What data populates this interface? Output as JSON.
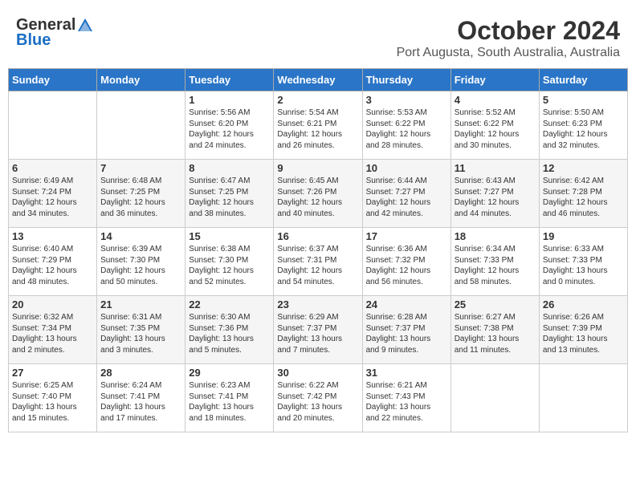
{
  "header": {
    "logo_general": "General",
    "logo_blue": "Blue",
    "month_title": "October 2024",
    "subtitle": "Port Augusta, South Australia, Australia"
  },
  "days_of_week": [
    "Sunday",
    "Monday",
    "Tuesday",
    "Wednesday",
    "Thursday",
    "Friday",
    "Saturday"
  ],
  "weeks": [
    {
      "row_class": "row-white",
      "days": [
        {
          "num": "",
          "info": ""
        },
        {
          "num": "",
          "info": ""
        },
        {
          "num": "1",
          "info": "Sunrise: 5:56 AM\nSunset: 6:20 PM\nDaylight: 12 hours\nand 24 minutes."
        },
        {
          "num": "2",
          "info": "Sunrise: 5:54 AM\nSunset: 6:21 PM\nDaylight: 12 hours\nand 26 minutes."
        },
        {
          "num": "3",
          "info": "Sunrise: 5:53 AM\nSunset: 6:22 PM\nDaylight: 12 hours\nand 28 minutes."
        },
        {
          "num": "4",
          "info": "Sunrise: 5:52 AM\nSunset: 6:22 PM\nDaylight: 12 hours\nand 30 minutes."
        },
        {
          "num": "5",
          "info": "Sunrise: 5:50 AM\nSunset: 6:23 PM\nDaylight: 12 hours\nand 32 minutes."
        }
      ]
    },
    {
      "row_class": "row-alt",
      "days": [
        {
          "num": "6",
          "info": "Sunrise: 6:49 AM\nSunset: 7:24 PM\nDaylight: 12 hours\nand 34 minutes."
        },
        {
          "num": "7",
          "info": "Sunrise: 6:48 AM\nSunset: 7:25 PM\nDaylight: 12 hours\nand 36 minutes."
        },
        {
          "num": "8",
          "info": "Sunrise: 6:47 AM\nSunset: 7:25 PM\nDaylight: 12 hours\nand 38 minutes."
        },
        {
          "num": "9",
          "info": "Sunrise: 6:45 AM\nSunset: 7:26 PM\nDaylight: 12 hours\nand 40 minutes."
        },
        {
          "num": "10",
          "info": "Sunrise: 6:44 AM\nSunset: 7:27 PM\nDaylight: 12 hours\nand 42 minutes."
        },
        {
          "num": "11",
          "info": "Sunrise: 6:43 AM\nSunset: 7:27 PM\nDaylight: 12 hours\nand 44 minutes."
        },
        {
          "num": "12",
          "info": "Sunrise: 6:42 AM\nSunset: 7:28 PM\nDaylight: 12 hours\nand 46 minutes."
        }
      ]
    },
    {
      "row_class": "row-white",
      "days": [
        {
          "num": "13",
          "info": "Sunrise: 6:40 AM\nSunset: 7:29 PM\nDaylight: 12 hours\nand 48 minutes."
        },
        {
          "num": "14",
          "info": "Sunrise: 6:39 AM\nSunset: 7:30 PM\nDaylight: 12 hours\nand 50 minutes."
        },
        {
          "num": "15",
          "info": "Sunrise: 6:38 AM\nSunset: 7:30 PM\nDaylight: 12 hours\nand 52 minutes."
        },
        {
          "num": "16",
          "info": "Sunrise: 6:37 AM\nSunset: 7:31 PM\nDaylight: 12 hours\nand 54 minutes."
        },
        {
          "num": "17",
          "info": "Sunrise: 6:36 AM\nSunset: 7:32 PM\nDaylight: 12 hours\nand 56 minutes."
        },
        {
          "num": "18",
          "info": "Sunrise: 6:34 AM\nSunset: 7:33 PM\nDaylight: 12 hours\nand 58 minutes."
        },
        {
          "num": "19",
          "info": "Sunrise: 6:33 AM\nSunset: 7:33 PM\nDaylight: 13 hours\nand 0 minutes."
        }
      ]
    },
    {
      "row_class": "row-alt",
      "days": [
        {
          "num": "20",
          "info": "Sunrise: 6:32 AM\nSunset: 7:34 PM\nDaylight: 13 hours\nand 2 minutes."
        },
        {
          "num": "21",
          "info": "Sunrise: 6:31 AM\nSunset: 7:35 PM\nDaylight: 13 hours\nand 3 minutes."
        },
        {
          "num": "22",
          "info": "Sunrise: 6:30 AM\nSunset: 7:36 PM\nDaylight: 13 hours\nand 5 minutes."
        },
        {
          "num": "23",
          "info": "Sunrise: 6:29 AM\nSunset: 7:37 PM\nDaylight: 13 hours\nand 7 minutes."
        },
        {
          "num": "24",
          "info": "Sunrise: 6:28 AM\nSunset: 7:37 PM\nDaylight: 13 hours\nand 9 minutes."
        },
        {
          "num": "25",
          "info": "Sunrise: 6:27 AM\nSunset: 7:38 PM\nDaylight: 13 hours\nand 11 minutes."
        },
        {
          "num": "26",
          "info": "Sunrise: 6:26 AM\nSunset: 7:39 PM\nDaylight: 13 hours\nand 13 minutes."
        }
      ]
    },
    {
      "row_class": "row-white",
      "days": [
        {
          "num": "27",
          "info": "Sunrise: 6:25 AM\nSunset: 7:40 PM\nDaylight: 13 hours\nand 15 minutes."
        },
        {
          "num": "28",
          "info": "Sunrise: 6:24 AM\nSunset: 7:41 PM\nDaylight: 13 hours\nand 17 minutes."
        },
        {
          "num": "29",
          "info": "Sunrise: 6:23 AM\nSunset: 7:41 PM\nDaylight: 13 hours\nand 18 minutes."
        },
        {
          "num": "30",
          "info": "Sunrise: 6:22 AM\nSunset: 7:42 PM\nDaylight: 13 hours\nand 20 minutes."
        },
        {
          "num": "31",
          "info": "Sunrise: 6:21 AM\nSunset: 7:43 PM\nDaylight: 13 hours\nand 22 minutes."
        },
        {
          "num": "",
          "info": ""
        },
        {
          "num": "",
          "info": ""
        }
      ]
    }
  ]
}
